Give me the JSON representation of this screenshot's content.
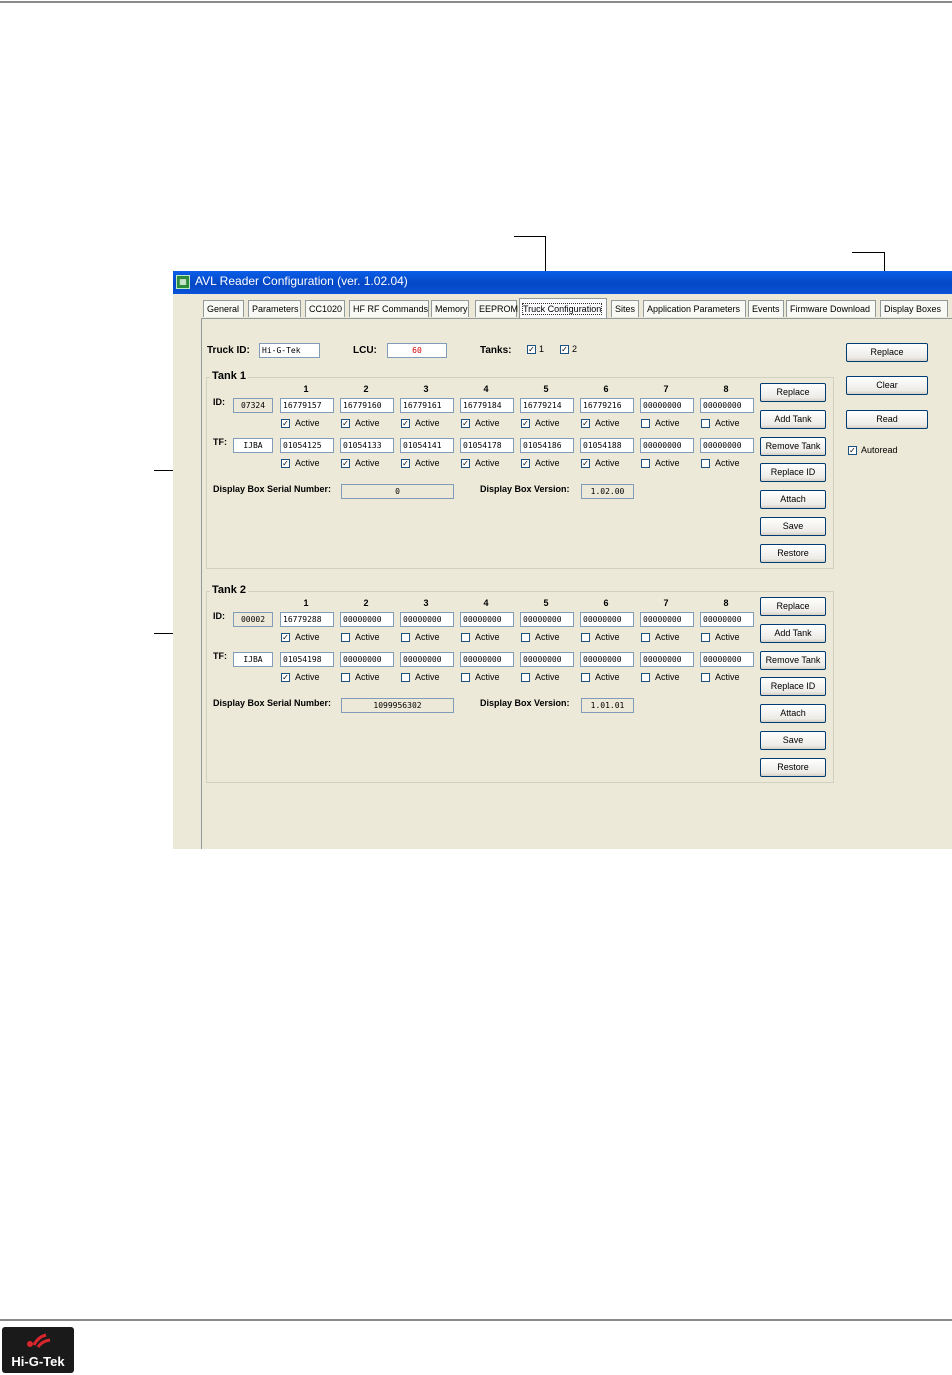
{
  "window": {
    "title": "AVL Reader Configuration (ver. 1.02.04)"
  },
  "tabs": [
    {
      "label": "General"
    },
    {
      "label": "Parameters"
    },
    {
      "label": "CC1020"
    },
    {
      "label": "HF RF Commands"
    },
    {
      "label": "Memory"
    },
    {
      "label": "EEPROM"
    },
    {
      "label": "Truck Configuration"
    },
    {
      "label": "Sites"
    },
    {
      "label": "Application Parameters"
    },
    {
      "label": "Events"
    },
    {
      "label": "Firmware Download"
    },
    {
      "label": "Display Boxes"
    }
  ],
  "active_tab": "Truck Configuration",
  "header": {
    "truck_id_label": "Truck ID:",
    "truck_id_value": "Hi-G-Tek",
    "lcu_label": "LCU:",
    "lcu_value": "60",
    "tanks_label": "Tanks:",
    "tank_checks": [
      {
        "label": "1",
        "checked": true
      },
      {
        "label": "2",
        "checked": true
      }
    ]
  },
  "side_buttons": {
    "replace": "Replace",
    "clear": "Clear",
    "read": "Read",
    "autoread": "Autoread",
    "autoread_checked": true
  },
  "columns": [
    "1",
    "2",
    "3",
    "4",
    "5",
    "6",
    "7",
    "8"
  ],
  "active_label": "Active",
  "id_label": "ID:",
  "tf_label": "TF:",
  "serial_label": "Display Box Serial Number:",
  "version_label": "Display Box Version:",
  "tank_buttons": [
    "Replace",
    "Add Tank",
    "Remove Tank",
    "Replace ID",
    "Attach",
    "Save",
    "Restore"
  ],
  "tank1": {
    "title": "Tank 1",
    "id_prefix": "07324",
    "ids": [
      "16779157",
      "16779160",
      "16779161",
      "16779184",
      "16779214",
      "16779216",
      "00000000",
      "00000000"
    ],
    "id_active": [
      true,
      true,
      true,
      true,
      true,
      true,
      false,
      false
    ],
    "tf_prefix": "IJBA",
    "tfs": [
      "01054125",
      "01054133",
      "01054141",
      "01054178",
      "01054186",
      "01054188",
      "00000000",
      "00000000"
    ],
    "tf_active": [
      true,
      true,
      true,
      true,
      true,
      true,
      false,
      false
    ],
    "serial": "0",
    "version": "1.02.00"
  },
  "tank2": {
    "title": "Tank 2",
    "id_prefix": "00002",
    "ids": [
      "16779288",
      "00000000",
      "00000000",
      "00000000",
      "00000000",
      "00000000",
      "00000000",
      "00000000"
    ],
    "id_active": [
      true,
      false,
      false,
      false,
      false,
      false,
      false,
      false
    ],
    "tf_prefix": "IJBA",
    "tfs": [
      "01054198",
      "00000000",
      "00000000",
      "00000000",
      "00000000",
      "00000000",
      "00000000",
      "00000000"
    ],
    "tf_active": [
      true,
      false,
      false,
      false,
      false,
      false,
      false,
      false
    ],
    "serial": "1099956302",
    "version": "1.01.01"
  },
  "footer": {
    "logo_text": "Hi-G-Tek"
  },
  "colors": {
    "titlebar": "#0548c6",
    "window_bg": "#ece9d8",
    "lcu_text": "#d00000"
  }
}
